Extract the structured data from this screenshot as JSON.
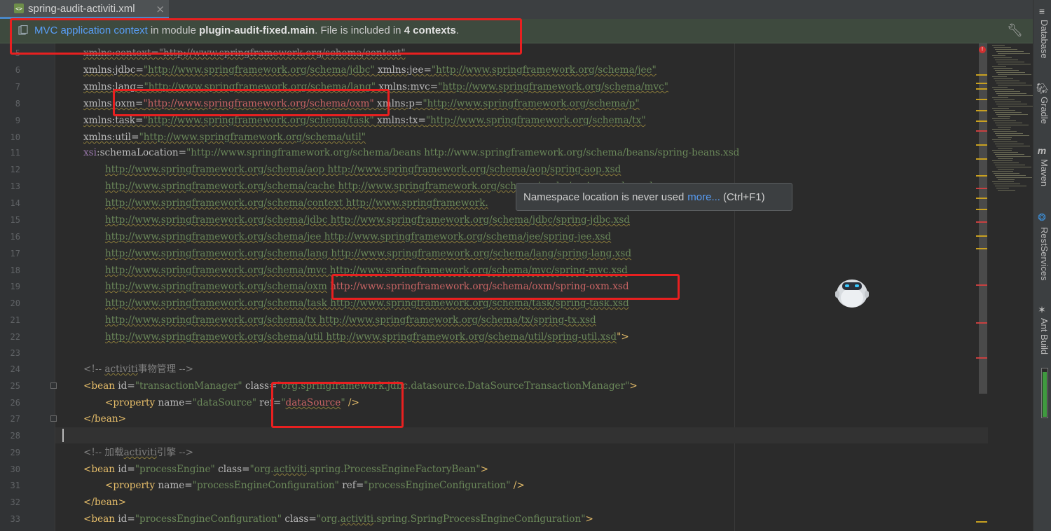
{
  "tab": {
    "title": "spring-audit-activiti.xml",
    "close": "×",
    "file_icon": "xml-file-icon"
  },
  "banner": {
    "link": "MVC application context",
    "t1": " in module ",
    "module": "plugin-audit-fixed.main",
    "t2": ". File is included in ",
    "contexts": "4 contexts",
    "t3": ".",
    "wrench": "wrench-icon"
  },
  "tooltip": {
    "text": "Namespace location is never used",
    "link": "more...",
    "shortcut": "(Ctrl+F1)"
  },
  "line_numbers": [
    "5",
    "6",
    "7",
    "8",
    "9",
    "10",
    "11",
    "12",
    "13",
    "14",
    "15",
    "16",
    "17",
    "18",
    "19",
    "20",
    "21",
    "22",
    "23",
    "24",
    "25",
    "26",
    "27",
    "28",
    "29",
    "30",
    "31",
    "32",
    "33"
  ],
  "code": {
    "l5": "xmlns:context=\"http://www.springframework.org/schema/context\"",
    "l6a": "xmlns:jdbc=",
    "l6b": "\"http://www.springframework.org/schema/jdbc\"",
    "l6c": " xmlns:jee=",
    "l6d": "\"http://www.springframework.org/schema/jee\"",
    "l7a": "xmlns:lang=",
    "l7b": "\"http://www.springframework.org/schema/lang\"",
    "l7c": " xmlns:mvc=",
    "l7d": "\"http://www.springframework.org/schema/mvc\"",
    "l8a": "xmlns:oxm=",
    "l8b": "\"http://www.springframework.org/schema/oxm\"",
    "l8c": " xmlns:p=",
    "l8d": "\"http://www.springframework.org/schema/p\"",
    "l9a": "xmlns:task=",
    "l9b": "\"http://www.springframework.org/schema/task\"",
    "l9c": " xmlns:tx=",
    "l9d": "\"http://www.springframework.org/schema/tx\"",
    "l10a": "xmlns:util=",
    "l10b": "\"http://www.springframework.org/schema/util\"",
    "l11a": "xsi",
    "l11b": ":schemaLocation=",
    "l11c": "\"http://www.springframework.org/schema/beans http://www.springframework.org/schema/beans/spring-beans.xsd",
    "l12": "http://www.springframework.org/schema/aop http://www.springframework.org/schema/aop/spring-aop.xsd",
    "l13": "http://www.springframework.org/schema/cache http://www.springframework.org/schema/cache/spring-cache.xsd",
    "l14": "http://www.springframework.org/schema/context http://www.springframework.",
    "l15": "http://www.springframework.org/schema/jdbc http://www.springframework.org/schema/jdbc/spring-jdbc.xsd",
    "l16": "http://www.springframework.org/schema/jee http://www.springframework.org/schema/jee/spring-jee.xsd",
    "l17": "http://www.springframework.org/schema/lang http://www.springframework.org/schema/lang/spring-lang.xsd",
    "l18": "http://www.springframework.org/schema/mvc http://www.springframework.org/schema/mvc/spring-mvc.xsd",
    "l19a": "http://www.springframework.org/schema/oxm",
    "l19b": " http://www.springframework.org/schema/oxm/spring-oxm.xsd",
    "l20": "http://www.springframework.org/schema/task http://www.springframework.org/schema/task/spring-task.xsd",
    "l21": "http://www.springframework.org/schema/tx http://www.springframework.org/schema/tx/spring-tx.xsd",
    "l22a": "http://www.springframework.org/schema/util http://www.springframework.org/schema/util/spring-util.xsd",
    "l22b": "\">",
    "l24a": "<!-- ",
    "l24b": "activiti",
    "l24c": "事物管理 -->",
    "l25a": "<bean",
    "l25b": " id=",
    "l25c": "\"transactionManager\"",
    "l25d": " class=",
    "l25e": "\"org.springframework.jdbc.datasource.DataSourceTransactionManager\"",
    "l25f": ">",
    "l26a": "<property",
    "l26b": " name=",
    "l26c": "\"dataSource\"",
    "l26d": " ref=",
    "l26e": "\"",
    "l26f": "dataSource",
    "l26g": "\"",
    "l26h": " />",
    "l27": "</bean>",
    "l29a": "<!-- 加载",
    "l29b": "activiti",
    "l29c": "引擎 -->",
    "l30a": "<bean",
    "l30b": " id=",
    "l30c": "\"processEngine\"",
    "l30d": " class=",
    "l30e": "\"org.",
    "l30f": "activiti",
    "l30g": ".spring.ProcessEngineFactoryBean\"",
    "l30h": ">",
    "l31a": "<property",
    "l31b": " name=",
    "l31c": "\"processEngineConfiguration\"",
    "l31d": " ref=",
    "l31e": "\"processEngineConfiguration\"",
    "l31f": " />",
    "l32": "</bean>",
    "l33a": "<bean",
    "l33b": " id=",
    "l33c": "\"processEngineConfiguration\"",
    "l33d": " class=",
    "l33e": "\"org.",
    "l33f": "activiti",
    "l33g": ".spring.SpringProcessEngineConfiguration\"",
    "l33h": ">"
  },
  "right_tools": {
    "database": "Database",
    "gradle": "Gradle",
    "maven": "Maven",
    "rest": "RestServices",
    "ant": "Ant Build",
    "database_icon": "database-icon",
    "gradle_icon": "gradle-icon",
    "maven_icon": "maven-icon",
    "rest_icon": "rest-services-icon",
    "ant_icon": "ant-icon"
  },
  "colors": {
    "accent": "#4a88c7",
    "link": "#589df6",
    "annotation_red": "#e82020",
    "string": "#6a8759",
    "tag": "#e8bf6a",
    "namespace": "#9876aa"
  }
}
